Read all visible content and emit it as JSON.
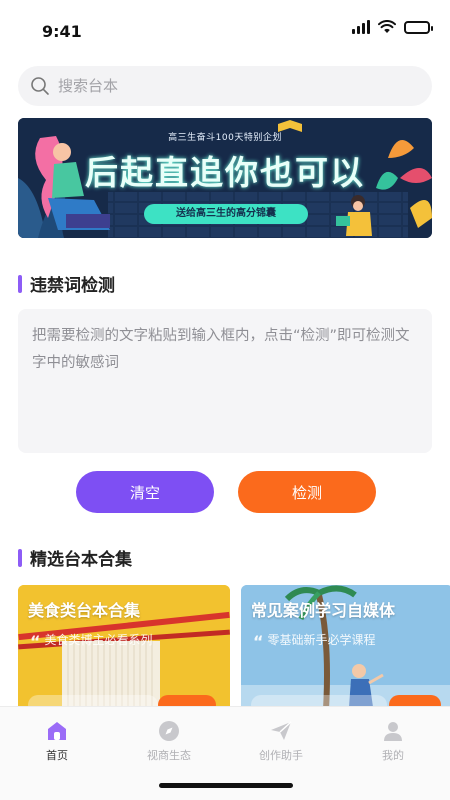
{
  "status_bar": {
    "time": "9:41"
  },
  "search": {
    "placeholder": "搜索台本"
  },
  "banner": {
    "top_text": "高三生奋斗100天特别企划",
    "title": "后起直追你也可以",
    "subtitle": "送给高三生的高分锦囊"
  },
  "detect_section": {
    "title": "违禁词检测",
    "placeholder": "把需要检测的文字粘贴到输入框内，点击“检测”即可检测文字中的敏感词",
    "clear_label": "清空",
    "detect_label": "检测"
  },
  "collections_section": {
    "title": "精选台本合集",
    "cards": [
      {
        "title": "美食类台本合集",
        "desc": "美食类博主必看系列"
      },
      {
        "title": "常见案例学习自媒体",
        "desc": "零基础新手必学课程"
      }
    ]
  },
  "tabbar": {
    "items": [
      {
        "label": "首页",
        "icon": "home-icon"
      },
      {
        "label": "视商生态",
        "icon": "compass-icon"
      },
      {
        "label": "创作助手",
        "icon": "paper-plane-icon"
      },
      {
        "label": "我的",
        "icon": "user-icon"
      }
    ]
  },
  "colors": {
    "accent_purple": "#7e4ff3",
    "accent_orange": "#fb6a1c",
    "section_bar": "#8d5cf6",
    "active_tab": "#8d5cf6"
  }
}
